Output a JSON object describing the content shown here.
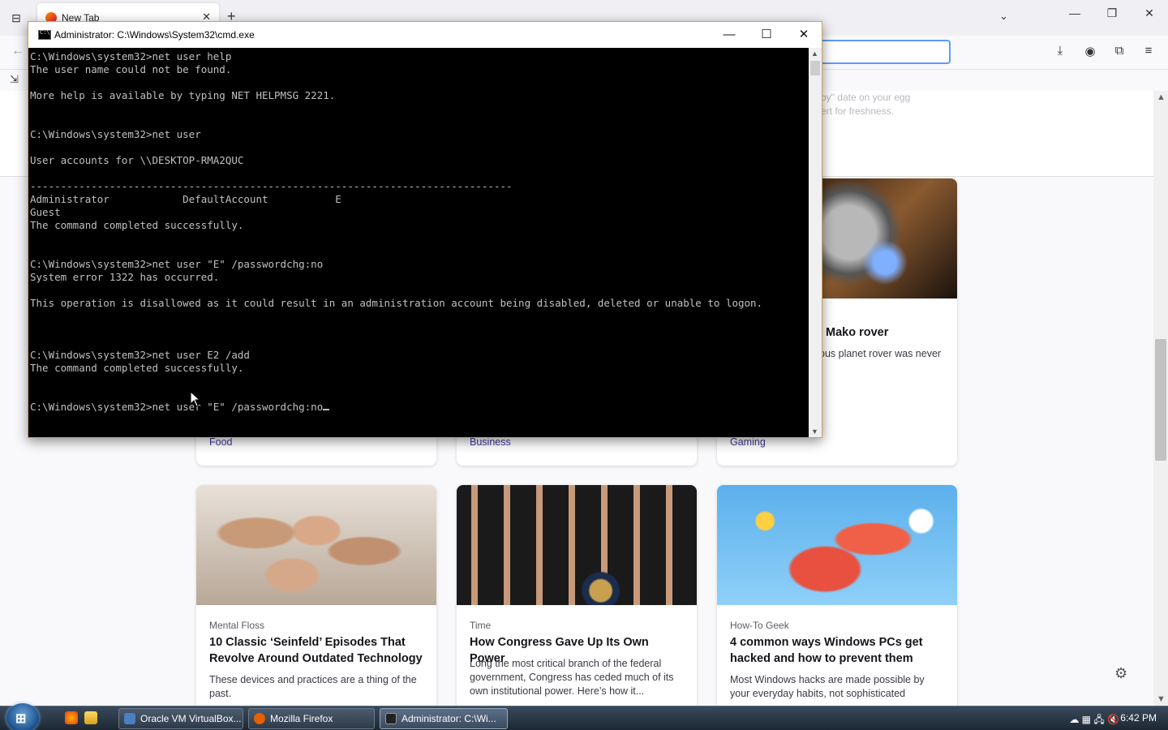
{
  "browser": {
    "tab_title": "New Tab",
    "tab_close": "✕",
    "new_tab": "+",
    "tab_list": "⊟",
    "chevron": "⌄",
    "minimize": "—",
    "restore": "❐",
    "close": "✕",
    "back": "←",
    "icons": {
      "download": "⤓",
      "account": "◉",
      "extensions": "⧉",
      "menu": "≡"
    },
    "import": "⇲"
  },
  "page": {
    "faded_lines": [
      "by\" date on your egg",
      "ert for freshness."
    ],
    "settings": "⚙"
  },
  "cards_top": [
    {
      "tag": "Food"
    },
    {
      "tag": "Business"
    },
    {
      "title": "Mako rover",
      "desc": "ous planet rover was never",
      "tag": "Gaming"
    }
  ],
  "cards_bottom": [
    {
      "source": "Mental Floss",
      "title": "10 Classic ‘Seinfeld’ Episodes That Revolve Around Outdated Technology",
      "desc": "These devices and practices are a thing of the past."
    },
    {
      "source": "Time",
      "title": "How Congress Gave Up Its Own Power",
      "desc": "Long the most critical branch of the federal government, Congress has ceded much of its own institutional power. Here’s how it..."
    },
    {
      "source": "How-To Geek",
      "title": "4 common ways Windows PCs get hacked and how to prevent them",
      "desc": "Most Windows hacks are made possible by your everyday habits, not sophisticated"
    }
  ],
  "cmd": {
    "title": "Administrator: C:\\Windows\\System32\\cmd.exe",
    "minimize": "—",
    "maximize": "☐",
    "close": "✕",
    "lines": [
      "C:\\Windows\\system32>net user help",
      "The user name could not be found.",
      "",
      "More help is available by typing NET HELPMSG 2221.",
      "",
      "",
      "C:\\Windows\\system32>net user",
      "",
      "User accounts for \\\\DESKTOP-RMA2QUC",
      "",
      "-------------------------------------------------------------------------------",
      "Administrator            DefaultAccount           E",
      "Guest",
      "The command completed successfully.",
      "",
      "",
      "C:\\Windows\\system32>net user \"E\" /passwordchg:no",
      "System error 1322 has occurred.",
      "",
      "This operation is disallowed as it could result in an administration account being disabled, deleted or unable to logon.",
      "",
      "",
      "",
      "C:\\Windows\\system32>net user E2 /add",
      "The command completed successfully.",
      "",
      "",
      "C:\\Windows\\system32>net user \"E\" /passwordchg:no"
    ]
  },
  "taskbar": {
    "start": "⊞",
    "buttons": [
      {
        "label": "Oracle VM VirtualBox...",
        "color": "#4a7fc1"
      },
      {
        "label": "Mozilla Firefox",
        "color": "#e66000"
      },
      {
        "label": "Administrator: C:\\Wi...",
        "color": "#222222"
      }
    ],
    "tray": "☁ ▦ 🖧 🔇",
    "clock": "6:42 PM"
  }
}
